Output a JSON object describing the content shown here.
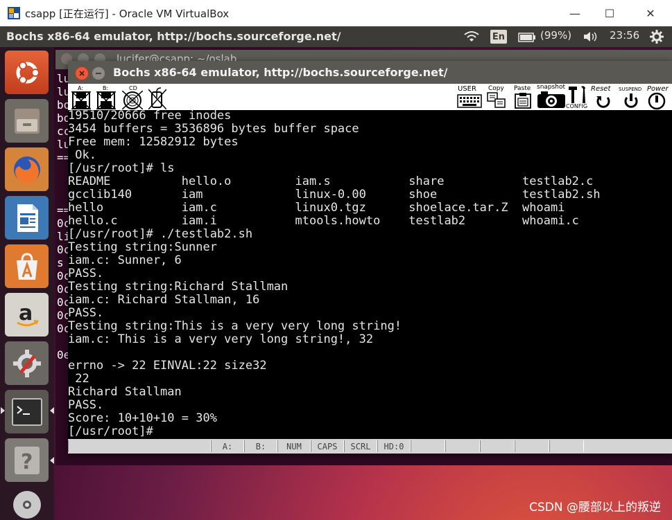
{
  "host_window": {
    "title": "csapp [正在运行] - Oracle VM VirtualBox",
    "minimize_glyph": "—",
    "maximize_glyph": "☐",
    "close_glyph": "✕"
  },
  "ubuntu_panel": {
    "app_title": "Bochs x86-64 emulator, http://bochs.sourceforge.net/",
    "keyboard_layout": "En",
    "battery": "(99%)",
    "clock": "23:56"
  },
  "launcher": {
    "items": [
      "ubuntu-dash",
      "files",
      "firefox",
      "libreoffice-writer",
      "software-center",
      "amazon",
      "system-settings",
      "terminal",
      "help",
      "dvd"
    ]
  },
  "background_terminal": {
    "title": "lucifer@csapp: ~/oslab",
    "visible_fragments": [
      "lu",
      "lu",
      "bo",
      "bo",
      "cc",
      "lu",
      "==",
      "",
      "",
      "",
      "==",
      "0c",
      "li",
      "0c",
      "s",
      "0c",
      "0c",
      "0c",
      "0c",
      "0c",
      "",
      "0e"
    ]
  },
  "bochs": {
    "title": "Bochs x86-64 emulator, http://bochs.sourceforge.net/",
    "toolbar": {
      "floppy_a": "A:",
      "floppy_b": "B:",
      "cdrom": "CD",
      "user": "USER",
      "copy": "Copy",
      "paste": "Paste",
      "snapshot": "snapshot",
      "config": "CONFIG",
      "reset": "Reset",
      "suspend": "SUSPEND",
      "power": "Power"
    },
    "screen_lines": [
      "19510/20666 free inodes",
      "3454 buffers = 3536896 bytes buffer space",
      "Free mem: 12582912 bytes",
      " Ok.",
      "[/usr/root]# ls",
      "README          hello.o         iam.s           share           testlab2.c",
      "gcclib140       iam             linux-0.00      shoe            testlab2.sh",
      "hello           iam.c           linux0.tgz      shoelace.tar.Z  whoami",
      "hello.c         iam.i           mtools.howto    testlab2        whoami.c",
      "[/usr/root]# ./testlab2.sh",
      "Testing string:Sunner",
      "iam.c: Sunner, 6",
      "PASS.",
      "Testing string:Richard Stallman",
      "iam.c: Richard Stallman, 16",
      "PASS.",
      "Testing string:This is a very very long string!",
      "iam.c: This is a very very long string!, 32",
      "",
      "errno -> 22 EINVAL:22 size32",
      " 22",
      "Richard Stallman",
      "PASS.",
      "Score: 10+10+10 = 30%",
      "[/usr/root]#"
    ],
    "status_cells": [
      "",
      "A:",
      "B:",
      "NUM",
      "CAPS",
      "SCRL",
      "HD:0",
      "",
      "",
      "",
      "",
      ""
    ]
  },
  "watermark": "CSDN @腰部以上的叛逆"
}
